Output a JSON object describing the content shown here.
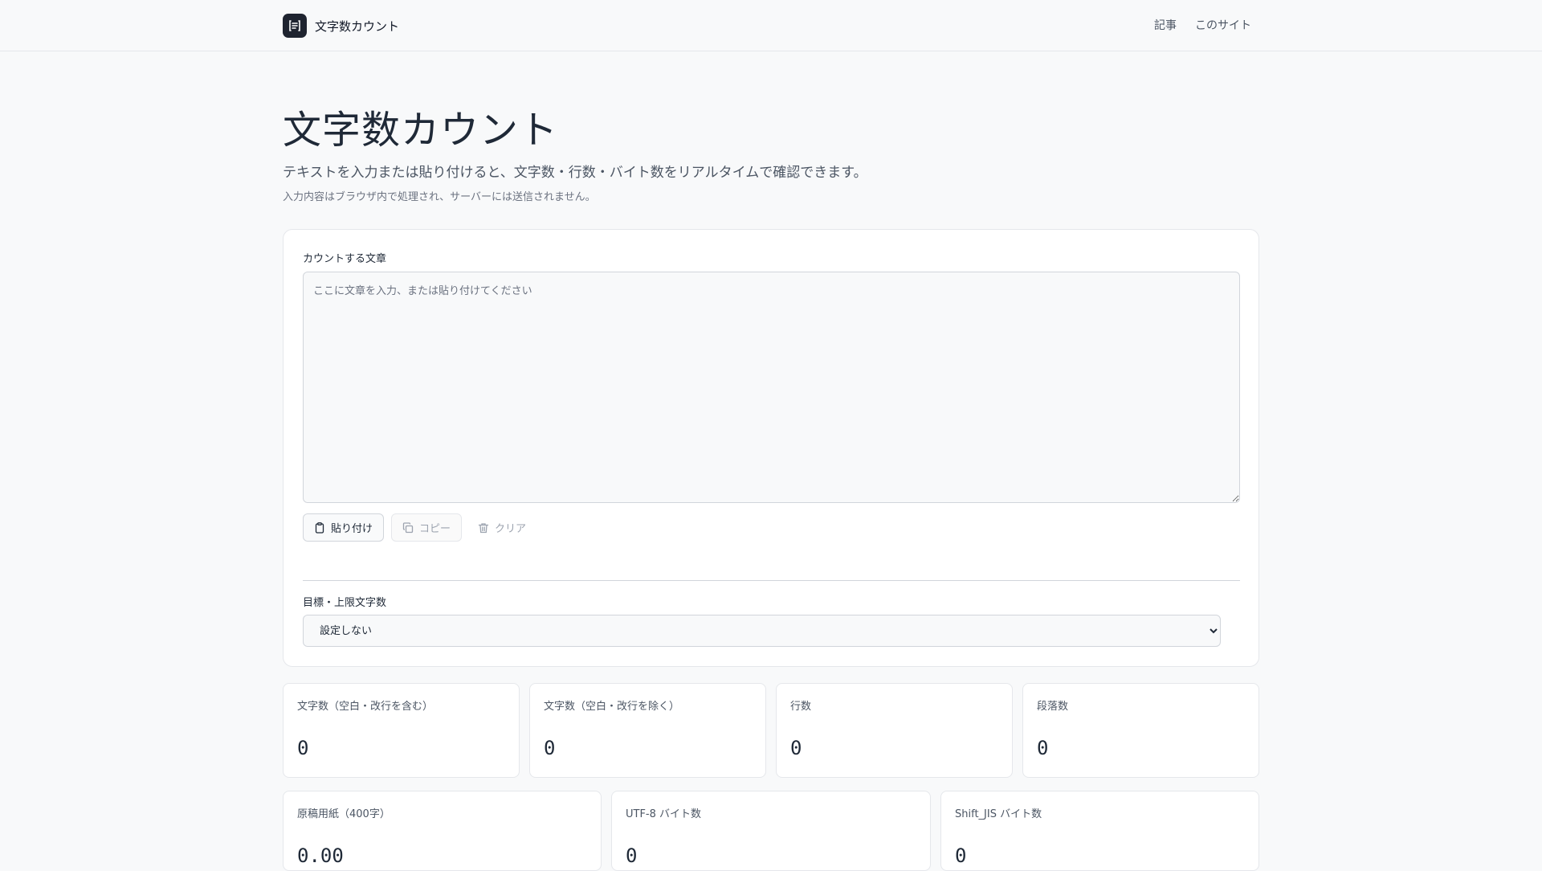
{
  "header": {
    "brand": "文字数カウント",
    "nav": [
      "記事",
      "このサイト"
    ]
  },
  "main": {
    "title": "文字数カウント",
    "lead": "テキストを入力または貼り付けると、文字数・行数・バイト数をリアルタイムで確認できます。",
    "note": "入力内容はブラウザ内で処理され、サーバーには送信されません。"
  },
  "editor": {
    "label": "カウントする文章",
    "value": "",
    "placeholder": "ここに文章を入力、または貼り付けてください",
    "paste_label": "貼り付け",
    "copy_label": "コピー",
    "clear_label": "クリア"
  },
  "target": {
    "label": "目標・上限文字数",
    "selected": "設定しない"
  },
  "stats_row1": [
    {
      "label": "文字数（空白・改行を含む）",
      "value": "0"
    },
    {
      "label": "文字数（空白・改行を除く）",
      "value": "0"
    },
    {
      "label": "行数",
      "value": "0"
    },
    {
      "label": "段落数",
      "value": "0"
    }
  ],
  "stats_row2": [
    {
      "label": "原稿用紙（400字）",
      "value": "0.00"
    },
    {
      "label": "UTF-8 バイト数",
      "value": "0"
    },
    {
      "label": "Shift_JIS バイト数",
      "value": "0"
    }
  ]
}
